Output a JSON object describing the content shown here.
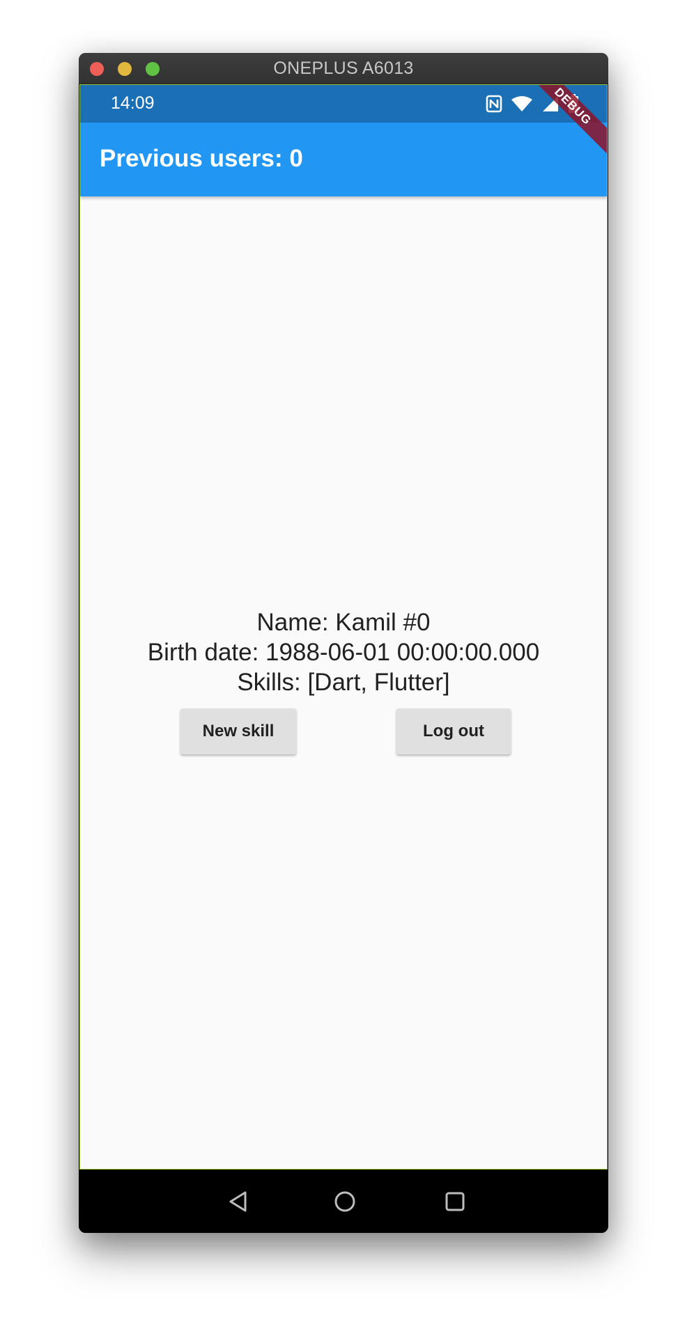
{
  "window": {
    "title": "ONEPLUS A6013"
  },
  "statusbar": {
    "time": "14:09",
    "icons": [
      "nfc-icon",
      "wifi-icon",
      "signal-icon",
      "battery-icon"
    ]
  },
  "appbar": {
    "title": "Previous users: 0",
    "color": "#2196f3"
  },
  "debug_banner": {
    "label": "DEBUG"
  },
  "user": {
    "name_line": "Name: Kamil #0",
    "birth_line": "Birth date: 1988-06-01 00:00:00.000",
    "skills_line": "Skills: [Dart, Flutter]"
  },
  "buttons": {
    "new_skill": "New skill",
    "log_out": "Log out"
  },
  "navbar": {
    "icons": [
      "back-icon",
      "home-icon",
      "recents-icon"
    ]
  }
}
